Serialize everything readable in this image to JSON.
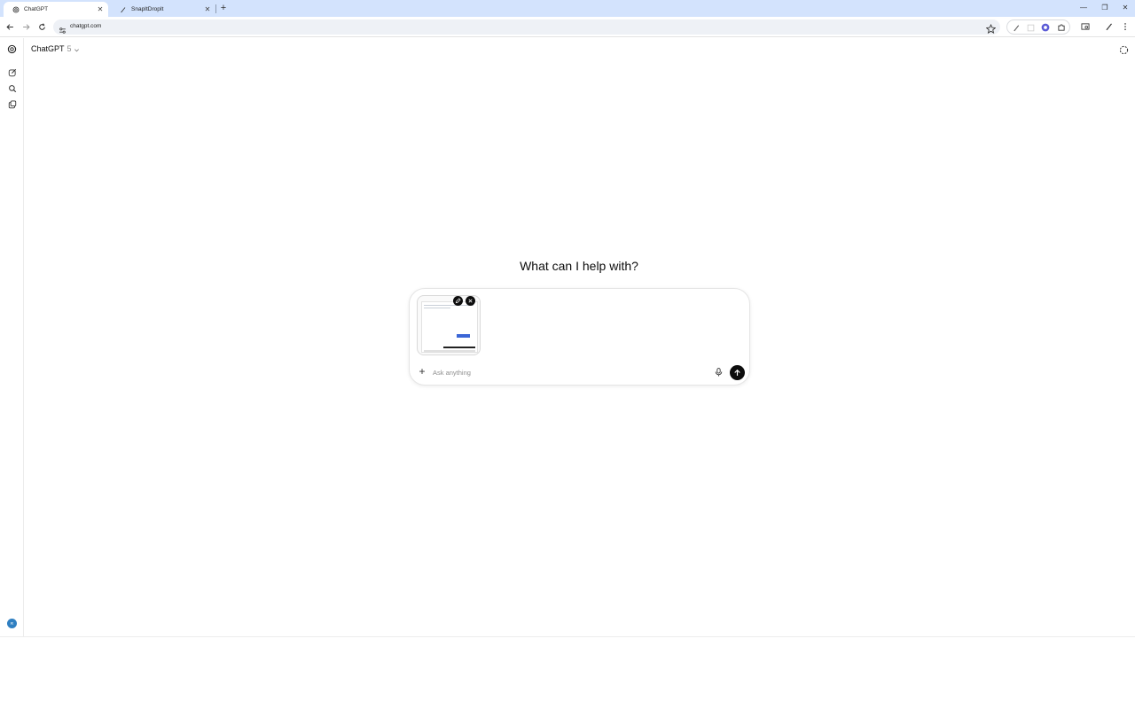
{
  "browser": {
    "tabs": [
      {
        "title": "ChatGPT",
        "icon": "openai-icon",
        "active": true
      },
      {
        "title": "SnapItDropIt",
        "icon": "pen-icon",
        "active": false
      }
    ],
    "url": "chatgpt.com"
  },
  "app": {
    "model_name": "ChatGPT",
    "model_version": "5",
    "heading": "What can I help with?",
    "composer": {
      "placeholder": "Ask anything",
      "value": ""
    },
    "avatar_initials": "R"
  },
  "colors": {
    "tabstrip": "#d3e3fd",
    "send_button": "#0d0d0d",
    "avatar": "#2f7fc1",
    "accent_extension": "#5b5bd6"
  }
}
